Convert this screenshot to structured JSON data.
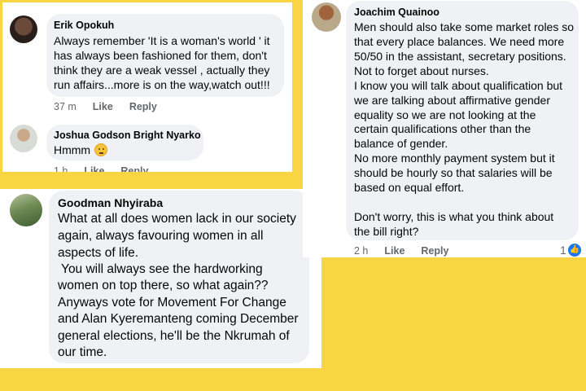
{
  "comments": {
    "erik": {
      "author": "Erik Opokuh",
      "lines": [
        "Always remember 'It is a woman's world ' it",
        "has always been fashioned for them, don't",
        "think they are a weak vessel , actually they",
        "run affairs...more is on the way,watch out!!!"
      ],
      "time": "37 m",
      "like": "Like",
      "reply": "Reply"
    },
    "joshua": {
      "author": "Joshua Godson Bright Nyarko",
      "text": "Hmmm",
      "emoji": "thinking-face-icon",
      "time": "1 h",
      "like": "Like",
      "reply": "Reply"
    },
    "goodman": {
      "author": "Goodman Nhyiraba",
      "lines": [
        "What at all does women lack in our society",
        "again, always favouring women in all",
        "aspects of life.",
        " You will always see the hardworking",
        "women on top there, so what again??",
        "Anyways vote for Movement For Change",
        "and Alan Kyeremanteng coming December",
        "general elections, he'll be the Nkrumah of",
        "our time."
      ]
    },
    "joachim": {
      "author": "Joachim Quainoo",
      "lines": [
        "Men should also take some market roles so",
        "that every place balances. We need more",
        "50/50 in the assistant, secretary positions.",
        "Not to forget about nurses.",
        "I know you will talk about qualification but",
        "we are talking about affirmative gender",
        "equality so we are not looking at the",
        "certain qualifications other than the",
        "balance of gender.",
        "No more monthly payment system but it",
        "should be hourly so that salaries will be",
        "based on equal effort.",
        "",
        "Don't worry, this is what you think about",
        "the bill right?"
      ],
      "time": "2 h",
      "like": "Like",
      "reply": "Reply",
      "reaction_count": "1",
      "reaction_icon": "thumbs-up-icon"
    }
  },
  "colors": {
    "highlight_yellow": "#f9d443",
    "bubble_gray": "#eff1f4",
    "meta_gray": "#65676b",
    "like_blue": "#1877f2"
  }
}
